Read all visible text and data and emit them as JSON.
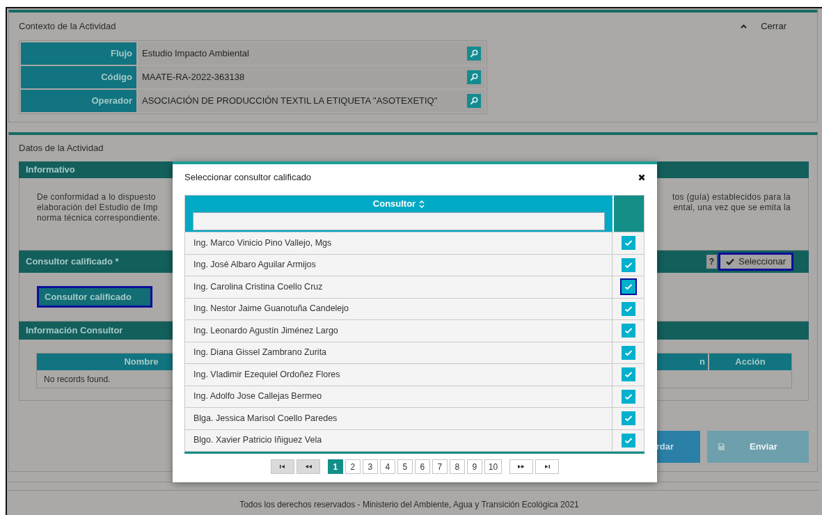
{
  "context_panel": {
    "title": "Contexto de la Actividad",
    "collapse_label": "Cerrar",
    "rows": [
      {
        "label": "Flujo",
        "value": "Estudio Impacto Ambiental"
      },
      {
        "label": "Código",
        "value": "MAATE-RA-2022-363138"
      },
      {
        "label": "Operador",
        "value": "ASOCIACIÓN DE PRODUCCIÓN TEXTIL LA ETIQUETA \"ASOTEXETIQ\""
      }
    ]
  },
  "activity_panel": {
    "title": "Datos de la Actividad",
    "informativo": {
      "title": "Informativo",
      "text_left": [
        "De conformidad a lo dispuesto",
        "elaboración del Estudio de Imp",
        "norma técnica correspondiente."
      ],
      "text_right": [
        "tos (guía) establecidos para la",
        "ental, una vez que se emita la"
      ]
    },
    "consultor_section": {
      "title": "Consultor calificado *",
      "help": "?",
      "select_button": "Seleccionar",
      "field_button": "Consultor calificado"
    },
    "info_section": {
      "title": "Información Consultor",
      "columns": [
        "Nombre",
        "n",
        "Acción"
      ],
      "empty": "No records found."
    },
    "buttons": [
      {
        "label": "rdar",
        "kind": "save",
        "disabled": false
      },
      {
        "label": "Enviar",
        "kind": "send",
        "disabled": true
      }
    ]
  },
  "modal": {
    "title": "Seleccionar consultor calificado",
    "column": "Consultor",
    "rows": [
      {
        "name": "Ing. Marco Vinicio Pino Vallejo, Mgs",
        "checked": true,
        "focused": false
      },
      {
        "name": "Ing. José Albaro Aguilar Armijos",
        "checked": true,
        "focused": false
      },
      {
        "name": "Ing. Carolina Cristina Coello Cruz",
        "checked": true,
        "focused": true
      },
      {
        "name": "Ing. Nestor Jaime Guanotuña Candelejo",
        "checked": true,
        "focused": false
      },
      {
        "name": "Ing. Leonardo Agustín Jiménez Largo",
        "checked": true,
        "focused": false
      },
      {
        "name": "Ing. Diana Gissel Zambrano Zurita",
        "checked": true,
        "focused": false
      },
      {
        "name": "Ing. Vladimir Ezequiel Ordoñez Flores",
        "checked": true,
        "focused": false
      },
      {
        "name": "Ing. Adolfo Jose Callejas Bermeo",
        "checked": true,
        "focused": false
      },
      {
        "name": "Blga. Jessica Marisol Coello Paredes",
        "checked": true,
        "focused": false
      },
      {
        "name": "Blgo. Xavier Patricio Iñiguez Vela",
        "checked": true,
        "focused": false
      }
    ],
    "pages": [
      {
        "label": "1",
        "selected": true
      },
      {
        "label": "2",
        "selected": false
      },
      {
        "label": "3",
        "selected": false
      },
      {
        "label": "4",
        "selected": false
      },
      {
        "label": "5",
        "selected": false
      },
      {
        "label": "6",
        "selected": false
      },
      {
        "label": "7",
        "selected": false
      },
      {
        "label": "8",
        "selected": false
      },
      {
        "label": "9",
        "selected": false
      },
      {
        "label": "10",
        "selected": false
      }
    ]
  },
  "footer": "Todos los derechos reservados - Ministerio del Ambiente, Agua y Transición Ecológica 2021"
}
